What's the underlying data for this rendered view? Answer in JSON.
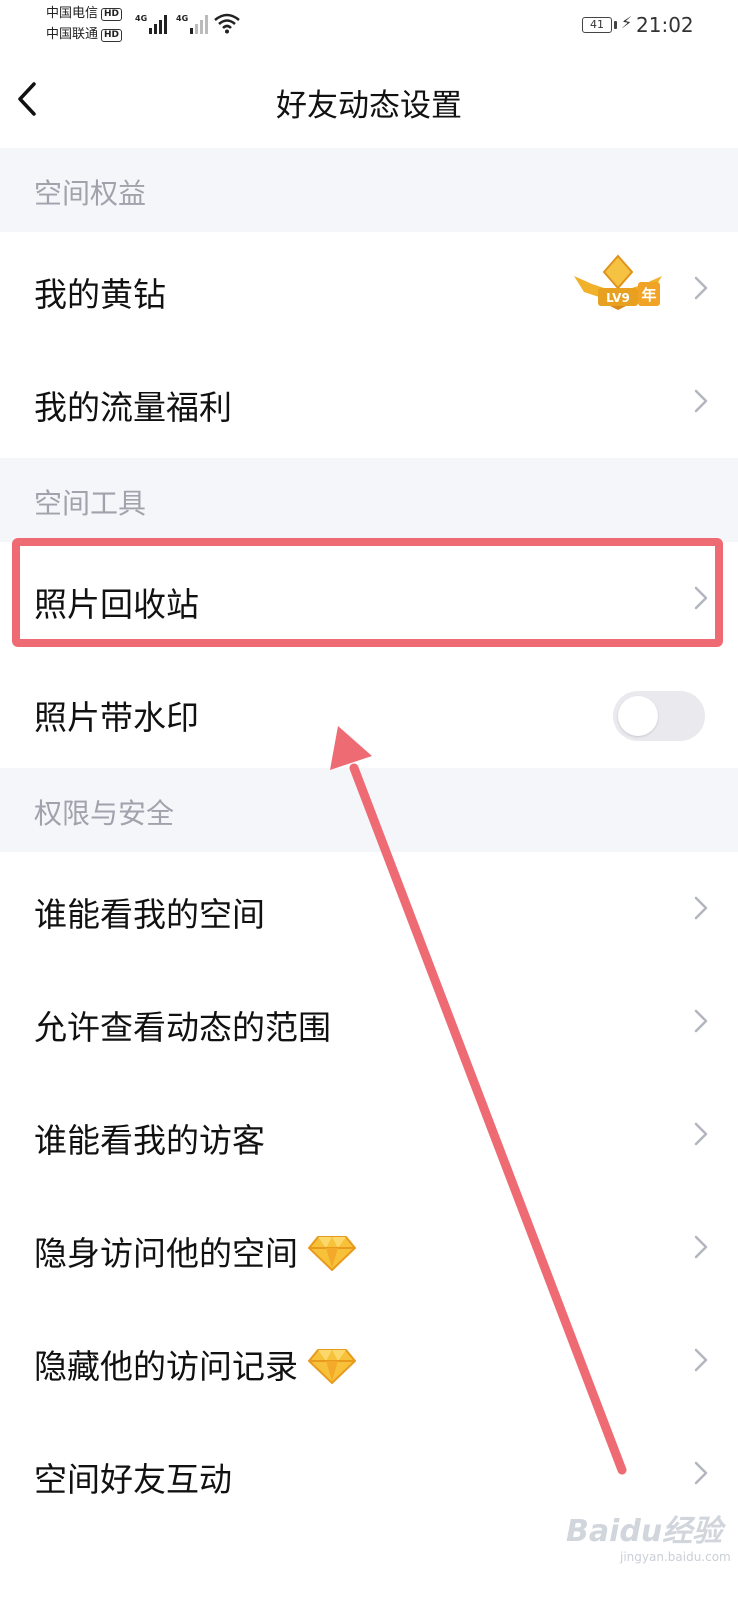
{
  "status_bar": {
    "carrier1": "中国电信",
    "carrier2": "中国联通",
    "hd": "HD",
    "network1": "4G",
    "network2": "4G",
    "battery": "41",
    "time": "21:02"
  },
  "nav": {
    "title": "好友动态设置"
  },
  "sections": [
    {
      "header": "空间权益",
      "items": [
        {
          "label": "我的黄钻",
          "badge_text": "LV9",
          "badge_year": "年"
        },
        {
          "label": "我的流量福利"
        }
      ]
    },
    {
      "header": "空间工具",
      "items": [
        {
          "label": "照片回收站"
        },
        {
          "label": "照片带水印",
          "toggle_on": false
        }
      ]
    },
    {
      "header": "权限与安全",
      "items": [
        {
          "label": "谁能看我的空间"
        },
        {
          "label": "允许查看动态的范围"
        },
        {
          "label": "谁能看我的访客"
        },
        {
          "label": "隐身访问他的空间",
          "icon": "diamond-icon"
        },
        {
          "label": "隐藏他的访问记录",
          "icon": "diamond-icon"
        },
        {
          "label": "空间好友互动"
        }
      ]
    }
  ],
  "annotation": {
    "color": "#ee6b74"
  },
  "watermark": {
    "text": "Baidu经验",
    "sub": "jingyan.baidu.com"
  }
}
